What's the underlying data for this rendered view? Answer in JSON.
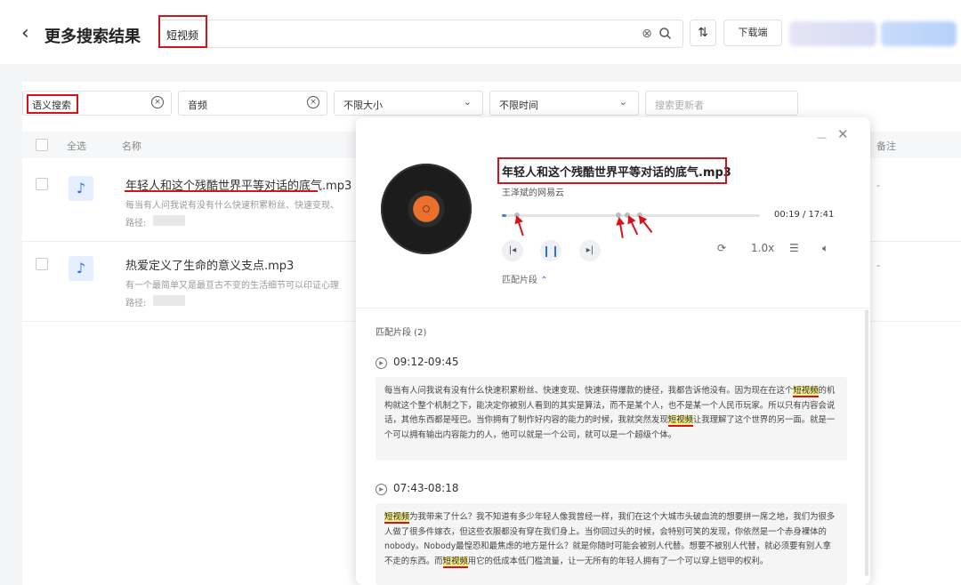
{
  "header": {
    "back_icon": "chevron-left-icon",
    "title": "更多搜索结果",
    "search_value": "短视频",
    "sort_icon": "sort-icon",
    "download_label": "下载端"
  },
  "filters": {
    "semantic": "语义搜索",
    "type": "音频",
    "size": "不限大小",
    "time": "不限时间",
    "updater_placeholder": "搜索更新者"
  },
  "table": {
    "select_all": "全选",
    "col_name": "名称",
    "col_remark": "备注",
    "rows": [
      {
        "name": "年轻人和这个残酷世界平等对话的底气.mp3",
        "snippet": "每当有人问我说有没有什么快速积累粉丝、快速变现、",
        "path_label": "路径:",
        "remark": "-"
      },
      {
        "name": "热爱定义了生命的意义支点.mp3",
        "snippet": "有一个最简单又是最亘古不变的生活细节可以印证心理",
        "path_label": "路径:",
        "remark": "-"
      }
    ]
  },
  "player": {
    "title": "年轻人和这个残酷世界平等对话的底气.mp3",
    "artist": "王泽斌的网易云",
    "progress": 0.018,
    "time": "00:19 / 17:41",
    "speed": "1.0x",
    "segments_toggle": "匹配片段",
    "segments_header": "匹配片段 (2)",
    "segments": [
      {
        "range": "09:12-09:45",
        "parts": [
          "每当有人问我说有没有什么快速积累粉丝、快速变现、快速获得爆款的捷径，我都告诉他没有。因为现在在这个",
          "短视频",
          "的机构就这个整个机制之下，能决定你被别人看到的其实是算法，而不是某个人，也不是某一个人民币玩家。所以只有内容会说话，其他东西都是哑巴。当你拥有了制作好内容的能力的时候，我就突然发现",
          "短视频",
          "让我理解了这个世界的另一面。就是一个可以拥有输出内容能力的人，他可以就是一个公司，就可以是一个超级个体。"
        ]
      },
      {
        "range": "07:43-08:18",
        "parts": [
          "",
          "短视频",
          "为我带来了什么？我不知道有多少年轻人像我曾经一样，我们在这个大城市头破血流的想要拼一席之地，我们为很多人做了很多件嫁衣，但这些衣服都没有穿在我们身上。当你回过头的时候，会特别可笑的发现，你依然是一个赤身裸体的nobody。Nobody最惶恐和最焦虑的地方是什么？就是你随时可能会被别人代替。想要不被别人代替，就必须要有别人拿不走的东西。而",
          "短视频",
          "用它的低成本低门槛流量，让一无所有的年轻人拥有了一个可以穿上铠甲的权利。"
        ]
      }
    ]
  }
}
